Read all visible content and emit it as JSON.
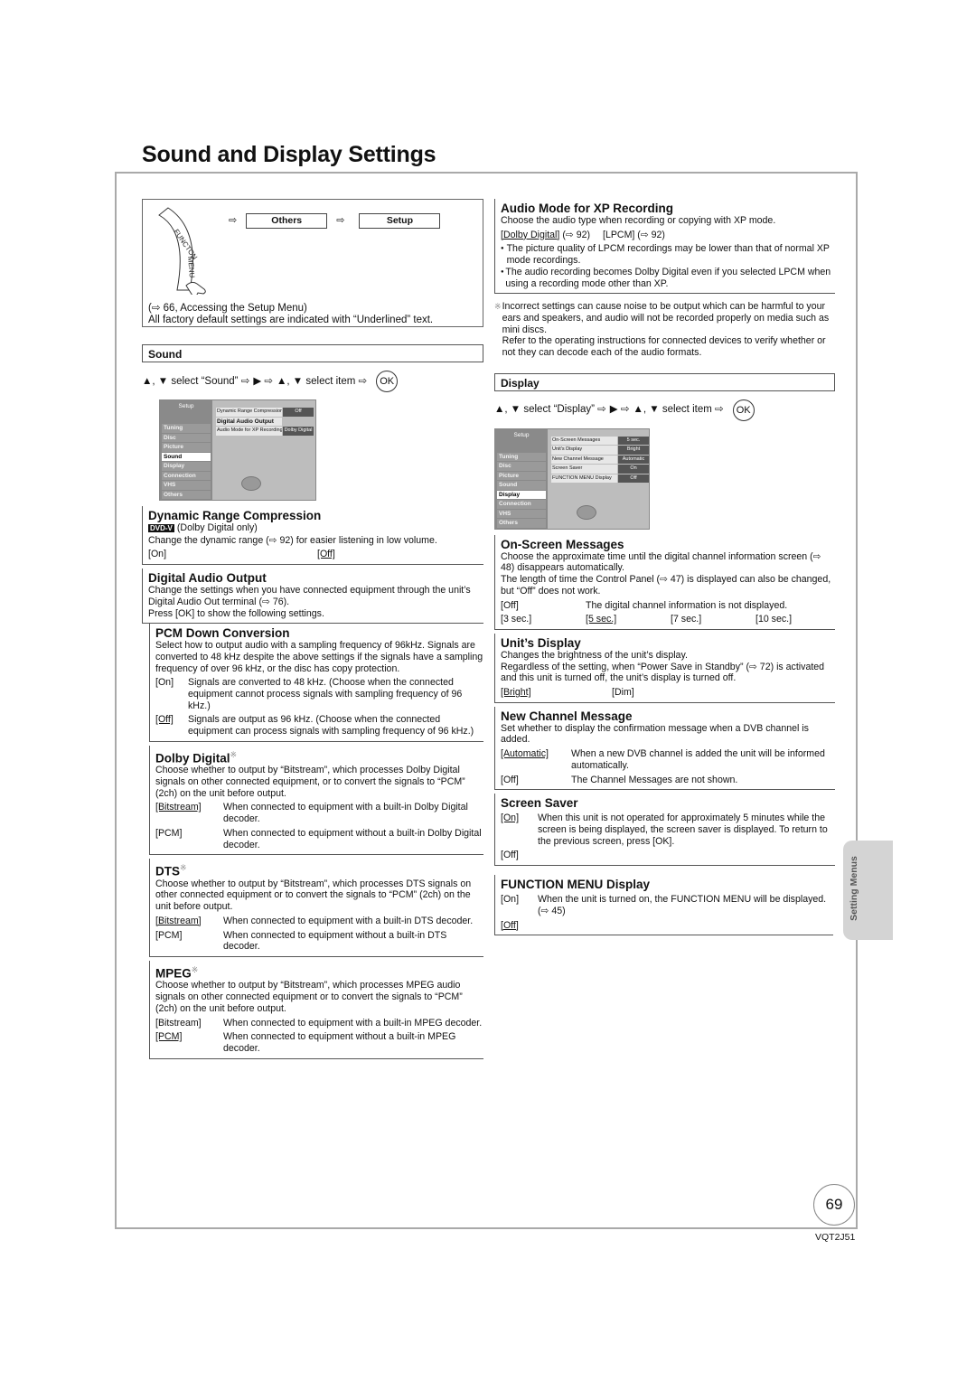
{
  "page_title": "Sound and Display Settings",
  "navigation": {
    "function_menu_label": "FUNCTION MENU",
    "arrow": "⇨",
    "step1": "Others",
    "step2": "Setup",
    "note_line1": "(⇨ 66, Accessing the Setup Menu)",
    "note_line2": "All factory default settings are indicated with “Underlined” text."
  },
  "sound": {
    "bar_label": "Sound",
    "instruction": [
      "▲, ▼ select “Sound” ⇨",
      "▶ ⇨",
      "▲, ▼ select item ⇨"
    ],
    "ok_label": "OK",
    "osd": {
      "title": "Setup",
      "menu": [
        "Tuning",
        "Disc",
        "Picture",
        "Sound",
        "Display",
        "Connection",
        "VHS",
        "Others"
      ],
      "selected": "Sound",
      "rows": [
        {
          "key": "Dynamic Range Compression",
          "value": "Off"
        },
        {
          "key": "Digital Audio Output",
          "value": ""
        },
        {
          "key": "Audio Mode for XP Recording",
          "value": "Dolby Digital"
        }
      ]
    },
    "sections": {
      "drc": {
        "title": "Dynamic Range Compression",
        "badge": "DVD-V",
        "badge_note": "(Dolby Digital only)",
        "desc": "Change the dynamic range (⇨ 92) for easier listening in low volume.",
        "opt_on": "[On]",
        "opt_off": "[Off]"
      },
      "dao": {
        "title": "Digital Audio Output",
        "desc1": "Change the settings when you have connected equipment through the unit’s Digital Audio Out terminal (⇨ 76).",
        "desc2": "Press [OK] to show the following settings."
      },
      "pcm": {
        "title": "PCM Down Conversion",
        "desc": "Select how to output audio with a sampling frequency of 96kHz. Signals are converted to 48 kHz despite the above settings if the signals have a sampling frequency of over 96 kHz, or the disc has copy protection.",
        "options": [
          {
            "key": "[On]",
            "desc": "Signals are converted to 48 kHz. (Choose when the connected equipment cannot process signals with sampling frequency of 96 kHz.)"
          },
          {
            "key": "[Off]",
            "desc": "Signals are output as 96 kHz. (Choose when the connected equipment can process signals with sampling frequency of 96 kHz.)"
          }
        ]
      },
      "dolby": {
        "title": "Dolby Digital",
        "mark": "※",
        "desc": "Choose whether to output by “Bitstream”, which processes Dolby Digital signals on other connected equipment, or to convert the signals to “PCM” (2ch) on the unit before output.",
        "options": [
          {
            "key": "[Bitstream]",
            "desc": "When connected to equipment with a built-in Dolby Digital decoder."
          },
          {
            "key": "[PCM]",
            "desc": "When connected to equipment without a built-in Dolby Digital decoder."
          }
        ]
      },
      "dts": {
        "title": "DTS",
        "mark": "※",
        "desc": "Choose whether to output by “Bitstream”, which processes DTS signals on other connected equipment or to convert the signals to “PCM” (2ch) on the unit before output.",
        "options": [
          {
            "key": "[Bitstream]",
            "desc": "When connected to equipment with a built-in DTS decoder."
          },
          {
            "key": "[PCM]",
            "desc": "When connected to equipment without a built-in DTS decoder."
          }
        ]
      },
      "mpeg": {
        "title": "MPEG",
        "mark": "※",
        "desc": "Choose whether to output by “Bitstream”, which processes MPEG audio signals on other connected equipment or to convert the signals to “PCM” (2ch) on the unit before output.",
        "options": [
          {
            "key": "[Bitstream]",
            "desc": "When connected to equipment with a built-in MPEG decoder."
          },
          {
            "key": "[PCM]",
            "desc": "When connected to equipment without a built-in MPEG decoder."
          }
        ]
      }
    }
  },
  "audio_xp": {
    "title": "Audio Mode for XP Recording",
    "desc": "Choose the audio type when recording or copying with XP mode.",
    "opt1": "[Dolby Digital]",
    "opt1_ref": "(⇨ 92)",
    "opt2": "[LPCM] (⇨ 92)",
    "bullets": [
      "The picture quality of LPCM recordings may be lower than that of normal XP mode recordings.",
      "The audio recording becomes Dolby Digital even if you selected LPCM when using a recording mode other than XP."
    ],
    "bullet_mark": "●"
  },
  "footnote": {
    "mark": "※",
    "line1": "Incorrect settings can cause noise to be output which can be harmful to your ears and speakers, and audio will not be recorded properly on media such as mini discs.",
    "line2": "Refer to the operating instructions for connected devices to verify whether or not they can decode each of the audio formats."
  },
  "display": {
    "bar_label": "Display",
    "instruction": [
      "▲, ▼ select “Display” ⇨",
      "▶ ⇨",
      "▲, ▼ select item ⇨"
    ],
    "ok_label": "OK",
    "osd": {
      "title": "Setup",
      "menu": [
        "Tuning",
        "Disc",
        "Picture",
        "Sound",
        "Display",
        "Connection",
        "VHS",
        "Others"
      ],
      "selected": "Display",
      "rows": [
        {
          "key": "On-Screen Messages",
          "value": "5 sec."
        },
        {
          "key": "Unit's Display",
          "value": "Bright"
        },
        {
          "key": "New Channel Message",
          "value": "Automatic"
        },
        {
          "key": "Screen Saver",
          "value": "On"
        },
        {
          "key": "FUNCTION MENU Display",
          "value": "Off"
        }
      ]
    },
    "sections": {
      "osm": {
        "title": "On-Screen Messages",
        "desc1": "Choose the approximate time until the digital channel information screen (⇨ 48) disappears automatically.",
        "desc2": "The length of time the Control Panel (⇨ 47) is displayed can also be changed, but “Off” does not work.",
        "off_key": "[Off]",
        "off_desc": "The digital channel information is not displayed.",
        "times": [
          "[3 sec.]",
          "[5 sec.]",
          "[7 sec.]",
          "[10 sec.]"
        ]
      },
      "unit": {
        "title": "Unit’s Display",
        "desc1": "Changes the brightness of the unit’s display.",
        "desc2": "Regardless of the setting, when “Power Save in Standby” (⇨ 72) is activated and this unit is turned off, the unit’s display is turned off.",
        "opt1": "[Bright]",
        "opt2": "[Dim]"
      },
      "ncm": {
        "title": "New Channel Message",
        "desc": "Set whether to display the confirmation message when a DVB channel is added.",
        "options": [
          {
            "key": "[Automatic]",
            "desc": "When a new DVB channel is added the unit will be informed automatically."
          },
          {
            "key": "[Off]",
            "desc": "The Channel Messages are not shown."
          }
        ]
      },
      "saver": {
        "title": "Screen Saver",
        "on_key": "[On]",
        "on_desc": "When this unit is not operated for approximately 5 minutes while the screen is being displayed, the screen saver is displayed. To return to the previous screen, press [OK].",
        "off_key": "[Off]"
      },
      "fmd": {
        "title": "FUNCTION MENU Display",
        "on_key": "[On]",
        "on_desc": "When the unit is turned on, the FUNCTION MENU will be displayed. (⇨ 45)",
        "off_key": "[Off]"
      }
    }
  },
  "side_tab": "Setting Menus",
  "page_number": "69",
  "doc_code": "VQT2J51"
}
